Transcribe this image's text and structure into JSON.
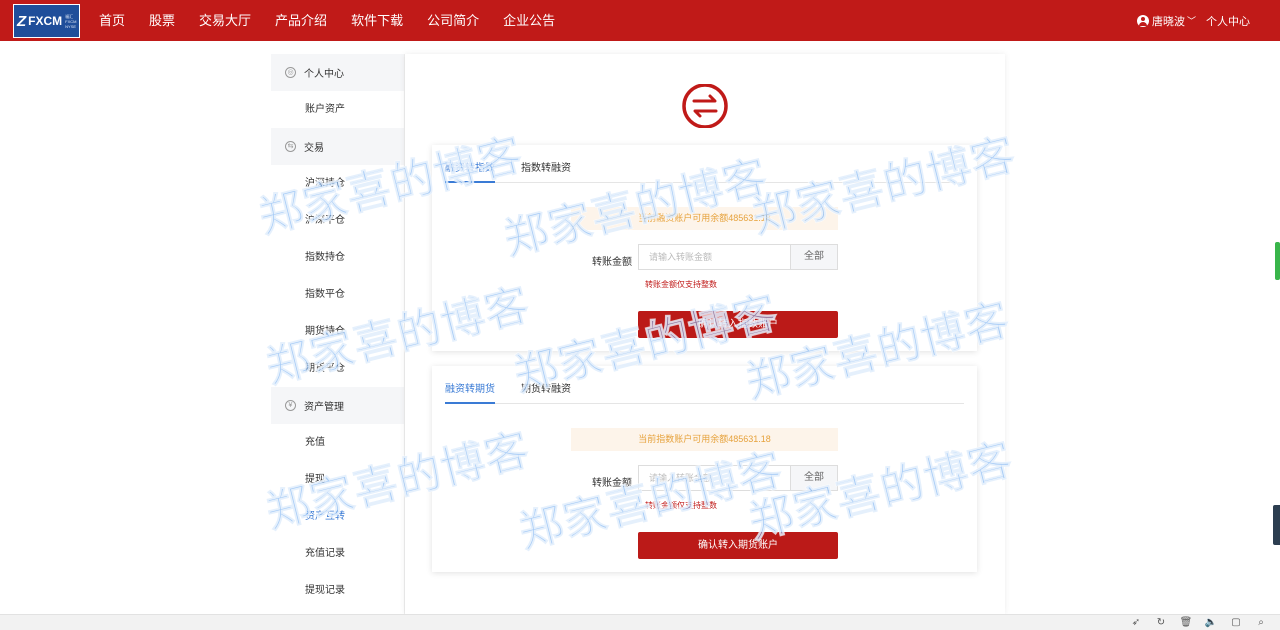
{
  "logo": {
    "mark": "Z",
    "text": "FXCM",
    "sub": [
      "福汇",
      "FXCM",
      "NYSE"
    ]
  },
  "nav": [
    "首页",
    "股票",
    "交易大厅",
    "产品介绍",
    "软件下载",
    "公司简介",
    "企业公告"
  ],
  "user": {
    "name": "唐晓波",
    "center": "个人中心"
  },
  "sidebar": {
    "groups": [
      {
        "label": "个人中心",
        "icon": "user-circle-icon",
        "items": [
          "账户资产"
        ]
      },
      {
        "label": "交易",
        "icon": "exchange-circle-icon",
        "items": [
          "沪深持仓",
          "沪深平仓",
          "指数持仓",
          "指数平仓",
          "期货持仓",
          "期货平仓"
        ]
      },
      {
        "label": "资产管理",
        "icon": "yen-circle-icon",
        "items": [
          "充值",
          "提现",
          "资产互转",
          "充值记录",
          "提现记录"
        ]
      }
    ],
    "active_item": "资产互转"
  },
  "cards": [
    {
      "tabs": [
        "融资转指数",
        "指数转融资"
      ],
      "notice": "当前融资账户可用余额485631.18",
      "label": "转账金额",
      "placeholder": "请输入转账金额",
      "all": "全部",
      "hint": "转账金额仅支持整数",
      "submit": "确认转入指数账户"
    },
    {
      "tabs": [
        "融资转期货",
        "期货转融资"
      ],
      "notice": "当前指数账户可用余额485631.18",
      "label": "转账金额",
      "placeholder": "请输入转账金额",
      "all": "全部",
      "hint": "转账金额仅支持整数",
      "submit": "确认转入期货账户"
    }
  ],
  "watermark": "郑家喜的博客",
  "colors": {
    "brand_red": "#c01a18",
    "accent_blue": "#3a7bd5",
    "notice_orange": "#e6a23c"
  },
  "browser_icons": [
    "rocket-icon",
    "refresh-icon",
    "trash-icon",
    "volume-icon",
    "window-icon",
    "search-icon"
  ]
}
